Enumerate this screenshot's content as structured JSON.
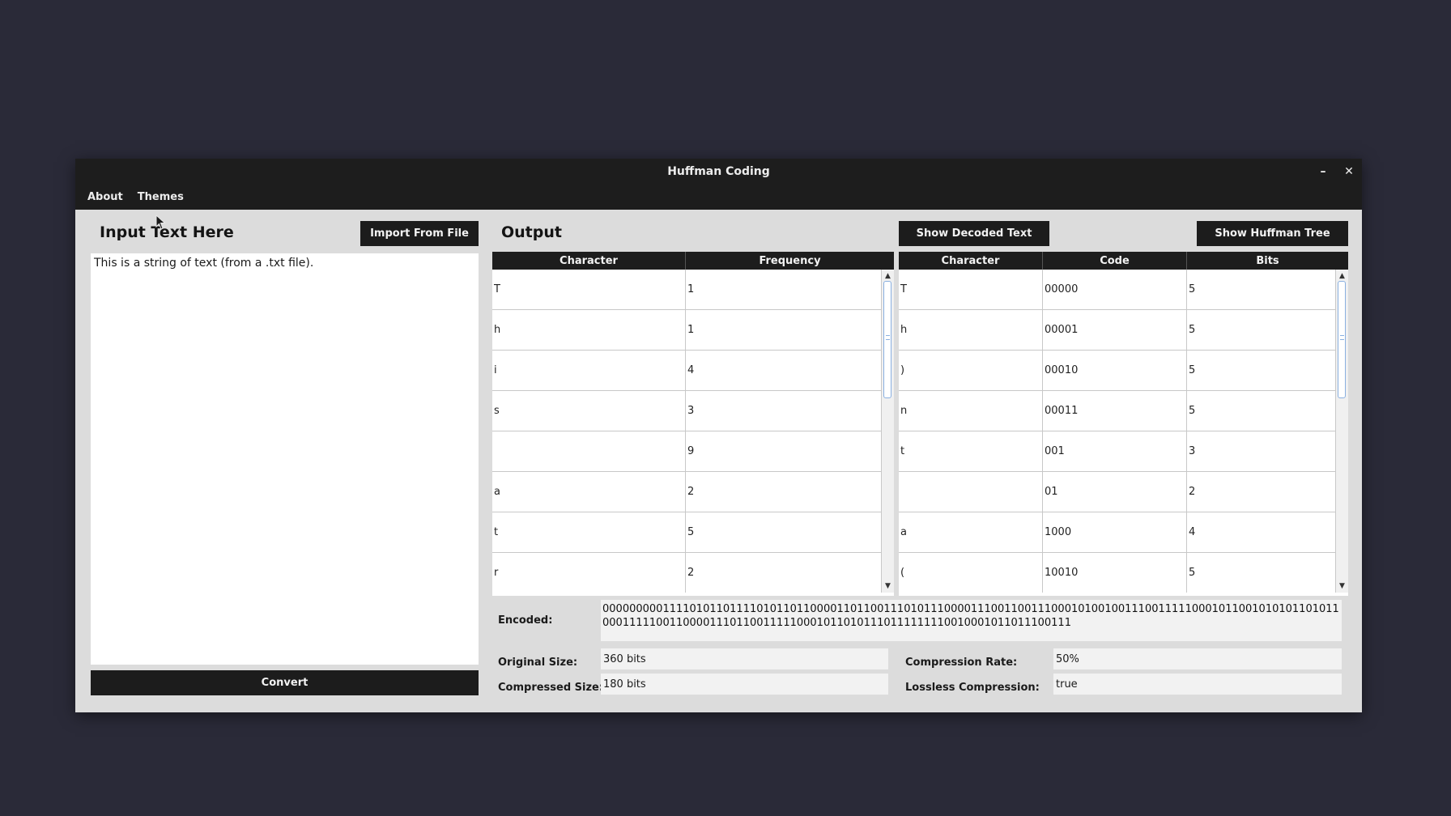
{
  "window": {
    "title": "Huffman Coding",
    "minimize_glyph": "–",
    "close_glyph": "✕"
  },
  "menu": [
    {
      "label": "About"
    },
    {
      "label": "Themes"
    }
  ],
  "input_panel": {
    "heading": "Input Text Here",
    "import_button": "Import From File",
    "text": "This is a string of text (from a .txt file).",
    "convert_button": "Convert"
  },
  "output_panel": {
    "heading": "Output",
    "show_decoded_button": "Show Decoded Text",
    "show_tree_button": "Show Huffman Tree"
  },
  "frequency_table": {
    "headers": [
      "Character",
      "Frequency"
    ],
    "rows": [
      [
        "T",
        "1"
      ],
      [
        "h",
        "1"
      ],
      [
        "i",
        "4"
      ],
      [
        "s",
        "3"
      ],
      [
        "",
        "9"
      ],
      [
        "a",
        "2"
      ],
      [
        "t",
        "5"
      ],
      [
        "r",
        "2"
      ]
    ]
  },
  "code_table": {
    "headers": [
      "Character",
      "Code",
      "Bits"
    ],
    "rows": [
      [
        "T",
        "00000",
        "5"
      ],
      [
        "h",
        "00001",
        "5"
      ],
      [
        ")",
        "00010",
        "5"
      ],
      [
        "n",
        "00011",
        "5"
      ],
      [
        "t",
        "001",
        "3"
      ],
      [
        "",
        "01",
        "2"
      ],
      [
        "a",
        "1000",
        "4"
      ],
      [
        "(",
        "10010",
        "5"
      ]
    ]
  },
  "stats": {
    "encoded_label": "Encoded:",
    "encoded_value": "000000000111101011011110101101100001101100111010111000011100110011100010100100111001111100010110010101011010110001111100110000111011001111100010110101110111111110010001011011100111",
    "original_size_label": "Original Size:",
    "original_size_value": "360 bits",
    "compressed_size_label": "Compressed Size:",
    "compressed_size_value": "180 bits",
    "compression_rate_label": "Compression Rate:",
    "compression_rate_value": "50%",
    "lossless_label": "Lossless Compression:",
    "lossless_value": "true"
  },
  "colors": {
    "desktop": "#2a2a38",
    "window_bg": "#dcdcdc",
    "titlebar": "#1d1d1d",
    "button": "#1c1c1c",
    "scroll_thumb_border": "#8ab0e0"
  },
  "icons": {
    "cursor": "mouse-pointer-icon",
    "scroll_up": "scroll-up-arrow-icon",
    "scroll_down": "scroll-down-arrow-icon"
  }
}
